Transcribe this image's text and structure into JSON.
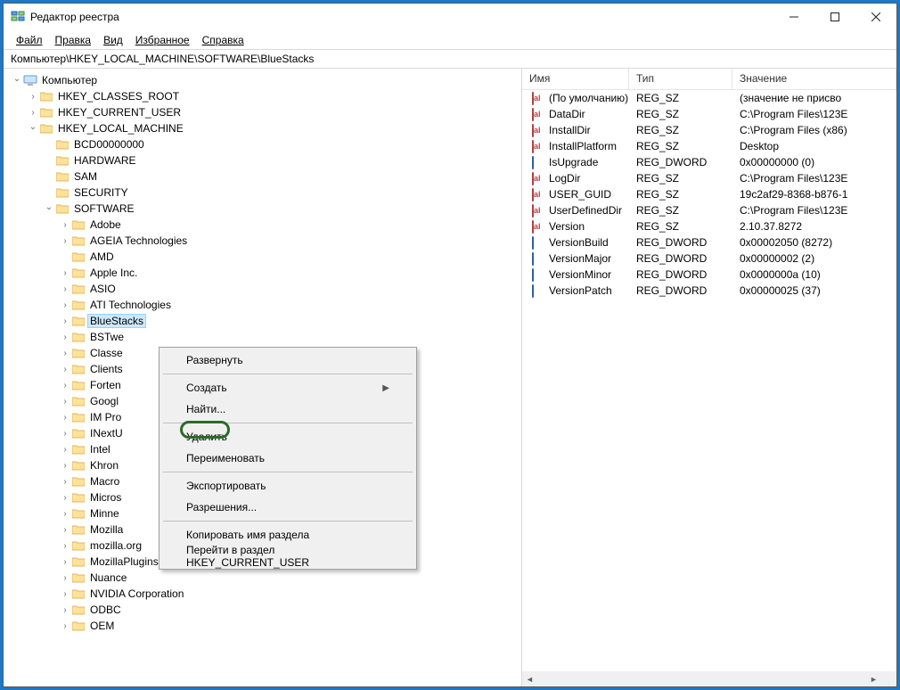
{
  "window": {
    "title": "Редактор реестра"
  },
  "menu": {
    "file": "Файл",
    "edit": "Правка",
    "view": "Вид",
    "fav": "Избранное",
    "help": "Справка"
  },
  "path": "Компьютер\\HKEY_LOCAL_MACHINE\\SOFTWARE\\BlueStacks",
  "tree": {
    "root": "Компьютер",
    "keys": [
      {
        "depth": 0,
        "expand": "open",
        "label": "Компьютер",
        "icon": "computer"
      },
      {
        "depth": 1,
        "expand": "closed",
        "label": "HKEY_CLASSES_ROOT"
      },
      {
        "depth": 1,
        "expand": "closed",
        "label": "HKEY_CURRENT_USER"
      },
      {
        "depth": 1,
        "expand": "open",
        "label": "HKEY_LOCAL_MACHINE"
      },
      {
        "depth": 2,
        "expand": "none",
        "label": "BCD00000000"
      },
      {
        "depth": 2,
        "expand": "none",
        "label": "HARDWARE"
      },
      {
        "depth": 2,
        "expand": "none",
        "label": "SAM"
      },
      {
        "depth": 2,
        "expand": "none",
        "label": "SECURITY"
      },
      {
        "depth": 2,
        "expand": "open",
        "label": "SOFTWARE"
      },
      {
        "depth": 3,
        "expand": "closed",
        "label": "Adobe"
      },
      {
        "depth": 3,
        "expand": "closed",
        "label": "AGEIA Technologies"
      },
      {
        "depth": 3,
        "expand": "none",
        "label": "AMD"
      },
      {
        "depth": 3,
        "expand": "closed",
        "label": "Apple Inc."
      },
      {
        "depth": 3,
        "expand": "closed",
        "label": "ASIO"
      },
      {
        "depth": 3,
        "expand": "closed",
        "label": "ATI Technologies"
      },
      {
        "depth": 3,
        "expand": "closed",
        "label": "BlueStacks",
        "selected": true
      },
      {
        "depth": 3,
        "expand": "closed",
        "label": "BSTwe"
      },
      {
        "depth": 3,
        "expand": "closed",
        "label": "Classe"
      },
      {
        "depth": 3,
        "expand": "closed",
        "label": "Clients"
      },
      {
        "depth": 3,
        "expand": "closed",
        "label": "Forten"
      },
      {
        "depth": 3,
        "expand": "closed",
        "label": "Googl"
      },
      {
        "depth": 3,
        "expand": "closed",
        "label": "IM Pro"
      },
      {
        "depth": 3,
        "expand": "closed",
        "label": "INextU"
      },
      {
        "depth": 3,
        "expand": "closed",
        "label": "Intel"
      },
      {
        "depth": 3,
        "expand": "closed",
        "label": "Khron"
      },
      {
        "depth": 3,
        "expand": "closed",
        "label": "Macro"
      },
      {
        "depth": 3,
        "expand": "closed",
        "label": "Micros"
      },
      {
        "depth": 3,
        "expand": "closed",
        "label": "Minne"
      },
      {
        "depth": 3,
        "expand": "closed",
        "label": "Mozilla"
      },
      {
        "depth": 3,
        "expand": "closed",
        "label": "mozilla.org"
      },
      {
        "depth": 3,
        "expand": "closed",
        "label": "MozillaPlugins"
      },
      {
        "depth": 3,
        "expand": "closed",
        "label": "Nuance"
      },
      {
        "depth": 3,
        "expand": "closed",
        "label": "NVIDIA Corporation"
      },
      {
        "depth": 3,
        "expand": "closed",
        "label": "ODBC"
      },
      {
        "depth": 3,
        "expand": "closed",
        "label": "OEM"
      }
    ]
  },
  "list": {
    "headers": {
      "name": "Имя",
      "type": "Тип",
      "value": "Значение"
    },
    "rows": [
      {
        "icon": "sz",
        "name": "(По умолчанию)",
        "type": "REG_SZ",
        "value": "(значение не присво"
      },
      {
        "icon": "sz",
        "name": "DataDir",
        "type": "REG_SZ",
        "value": "C:\\Program Files\\123E"
      },
      {
        "icon": "sz",
        "name": "InstallDir",
        "type": "REG_SZ",
        "value": "C:\\Program Files (x86)"
      },
      {
        "icon": "sz",
        "name": "InstallPlatform",
        "type": "REG_SZ",
        "value": "Desktop"
      },
      {
        "icon": "dw",
        "name": "IsUpgrade",
        "type": "REG_DWORD",
        "value": "0x00000000 (0)"
      },
      {
        "icon": "sz",
        "name": "LogDir",
        "type": "REG_SZ",
        "value": "C:\\Program Files\\123E"
      },
      {
        "icon": "sz",
        "name": "USER_GUID",
        "type": "REG_SZ",
        "value": "19c2af29-8368-b876-1"
      },
      {
        "icon": "sz",
        "name": "UserDefinedDir",
        "type": "REG_SZ",
        "value": "C:\\Program Files\\123E"
      },
      {
        "icon": "sz",
        "name": "Version",
        "type": "REG_SZ",
        "value": "2.10.37.8272"
      },
      {
        "icon": "dw",
        "name": "VersionBuild",
        "type": "REG_DWORD",
        "value": "0x00002050 (8272)"
      },
      {
        "icon": "dw",
        "name": "VersionMajor",
        "type": "REG_DWORD",
        "value": "0x00000002 (2)"
      },
      {
        "icon": "dw",
        "name": "VersionMinor",
        "type": "REG_DWORD",
        "value": "0x0000000a (10)"
      },
      {
        "icon": "dw",
        "name": "VersionPatch",
        "type": "REG_DWORD",
        "value": "0x00000025 (37)"
      }
    ]
  },
  "contextMenu": {
    "items": [
      {
        "label": "Развернуть",
        "sep": false
      },
      {
        "sep": true
      },
      {
        "label": "Создать",
        "sub": true,
        "sep": false
      },
      {
        "label": "Найти...",
        "sep": false
      },
      {
        "sep": true
      },
      {
        "label": "Удалить",
        "sep": false
      },
      {
        "label": "Переименовать",
        "sep": false
      },
      {
        "sep": true
      },
      {
        "label": "Экспортировать",
        "sep": false
      },
      {
        "label": "Разрешения...",
        "sep": false
      },
      {
        "sep": true
      },
      {
        "label": "Копировать имя раздела",
        "sep": false
      },
      {
        "label": "Перейти в раздел HKEY_CURRENT_USER",
        "sep": false
      }
    ]
  }
}
